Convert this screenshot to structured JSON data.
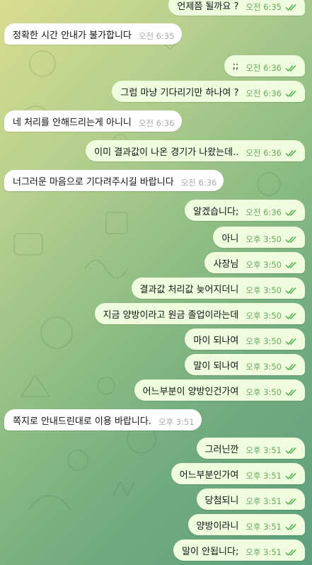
{
  "colors": {
    "incoming_bg": "#ffffff",
    "outgoing_bg": "#effdde",
    "time_out": "#6aa860",
    "check": "#4fae4e"
  },
  "messages": [
    {
      "dir": "out",
      "text": "언제쯤 될까요 ?",
      "time": "오전 6:35",
      "read": true
    },
    {
      "dir": "in",
      "text": "정확한 시간 안내가 불가합니다",
      "time": "오전 6:35"
    },
    {
      "dir": "out",
      "text": ";;",
      "time": "오전 6:36",
      "read": true
    },
    {
      "dir": "out",
      "text": "그럼 마냥 기다리기만 하나여 ?",
      "time": "오전 6:36",
      "read": true
    },
    {
      "dir": "in",
      "text": "네 처리를 안해드리는게 아니니",
      "time": "오전 6:36"
    },
    {
      "dir": "out",
      "text": "이미 결과값이 나온 경기가 나왔는데..",
      "time": "오전 6:36",
      "read": true
    },
    {
      "dir": "in",
      "text": "너그러운 마음으로 기다려주시길 바랍니다",
      "time": "오전 6:36"
    },
    {
      "dir": "out",
      "text": "알겠습니다;",
      "time": "오전 6:36",
      "read": true
    },
    {
      "dir": "out",
      "text": "아니",
      "time": "오후 3:50",
      "read": true
    },
    {
      "dir": "out",
      "text": "사장님",
      "time": "오후 3:50",
      "read": true
    },
    {
      "dir": "out",
      "text": "결과값 처리값 늦어지더니",
      "time": "오후 3:50",
      "read": true
    },
    {
      "dir": "out",
      "text": "지금 양방이라고 원금 졸업이라는데",
      "time": "오후 3:50",
      "read": true
    },
    {
      "dir": "out",
      "text": "마이 되나여",
      "time": "오후 3:50",
      "read": true
    },
    {
      "dir": "out",
      "text": "말이 되나여",
      "time": "오후 3:50",
      "read": true
    },
    {
      "dir": "out",
      "text": "어느부분이 양방인건가여",
      "time": "오후 3:50",
      "read": true
    },
    {
      "dir": "in",
      "text": "쪽지로 안내드린대로 이용 바랍니다.",
      "time": "오후 3:51"
    },
    {
      "dir": "out",
      "text": "그러닌깐",
      "time": "오후 3:51",
      "read": true
    },
    {
      "dir": "out",
      "text": "어느부분인가여",
      "time": "오후 3:51",
      "read": true
    },
    {
      "dir": "out",
      "text": "당첨되니",
      "time": "오후 3:51",
      "read": true
    },
    {
      "dir": "out",
      "text": "양방이라니",
      "time": "오후 3:51",
      "read": true
    },
    {
      "dir": "out",
      "text": "말이 안됩니다;",
      "time": "오후 3:51",
      "read": true
    }
  ]
}
